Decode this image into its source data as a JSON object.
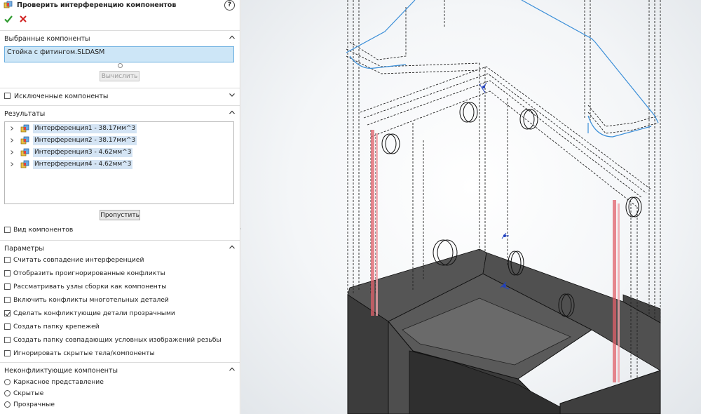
{
  "panel": {
    "title": "Проверить интерференцию компонентов",
    "help_glyph": "?",
    "icons": {
      "ok": "checkmark-icon",
      "cancel": "close-icon",
      "help": "help-icon"
    }
  },
  "selected_components": {
    "header": "Выбранные компоненты",
    "value": "Стойка с фитингом.SLDASM",
    "calculate_button": "Вычислить"
  },
  "excluded_components": {
    "label": "Исключенные компоненты",
    "checked": false
  },
  "results": {
    "header": "Результаты",
    "items": [
      {
        "label": "Интерференция1 - 38.17мм^3"
      },
      {
        "label": "Интерференция2 - 38.17мм^3"
      },
      {
        "label": "Интерференция3 - 4.62мм^3"
      },
      {
        "label": "Интерференция4 - 4.62мм^3"
      }
    ],
    "skip_button": "Пропустить",
    "component_view_label": "Вид компонентов"
  },
  "parameters": {
    "header": "Параметры",
    "options": [
      {
        "label": "Считать совпадение интерференцией",
        "checked": false
      },
      {
        "label": "Отобразить проигнорированные конфликты",
        "checked": false
      },
      {
        "label": "Рассматривать узлы сборки как компоненты",
        "checked": false
      },
      {
        "label": "Включить конфликты многотельных деталей",
        "checked": false
      },
      {
        "label": "Сделать конфликтующие детали прозрачными",
        "checked": true
      },
      {
        "label": "Создать папку крепежей",
        "checked": false
      },
      {
        "label": "Создать папку совпадающих условных изображений резьбы",
        "checked": false
      },
      {
        "label": "Игнорировать скрытые тела/компоненты",
        "checked": false
      }
    ]
  },
  "non_conflicting": {
    "header": "Неконфликтующие компоненты",
    "options": [
      {
        "label": "Каркасное представление"
      },
      {
        "label": "Скрытые"
      },
      {
        "label": "Прозрачные"
      }
    ]
  },
  "colors": {
    "accent": "#cde6f7",
    "selection_border": "#6aaee0",
    "interference": "#e0606a",
    "edge_blue": "#3a8ed8",
    "model_dark": "#4a4a4a"
  }
}
